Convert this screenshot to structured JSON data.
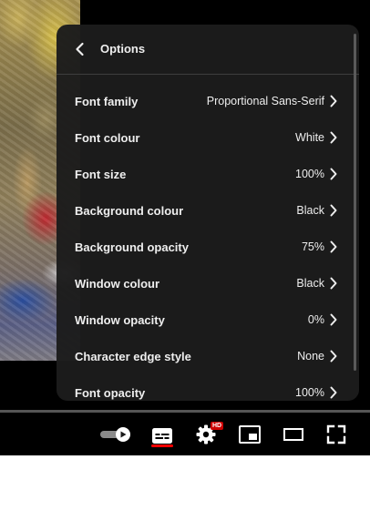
{
  "panel": {
    "title": "Options",
    "rows": [
      {
        "label": "Font family",
        "value": "Proportional Sans-Serif"
      },
      {
        "label": "Font colour",
        "value": "White"
      },
      {
        "label": "Font size",
        "value": "100%"
      },
      {
        "label": "Background colour",
        "value": "Black"
      },
      {
        "label": "Background opacity",
        "value": "75%"
      },
      {
        "label": "Window colour",
        "value": "Black"
      },
      {
        "label": "Window opacity",
        "value": "0%"
      },
      {
        "label": "Character edge style",
        "value": "None"
      },
      {
        "label": "Font opacity",
        "value": "100%"
      }
    ]
  },
  "controls": {
    "hd_badge": "HD",
    "autoplay_on": true,
    "accent_color": "#ff0000",
    "icons": [
      "autoplay-toggle-icon",
      "subtitles-icon",
      "settings-gear-icon",
      "miniplayer-icon",
      "theater-mode-icon",
      "fullscreen-icon"
    ]
  }
}
